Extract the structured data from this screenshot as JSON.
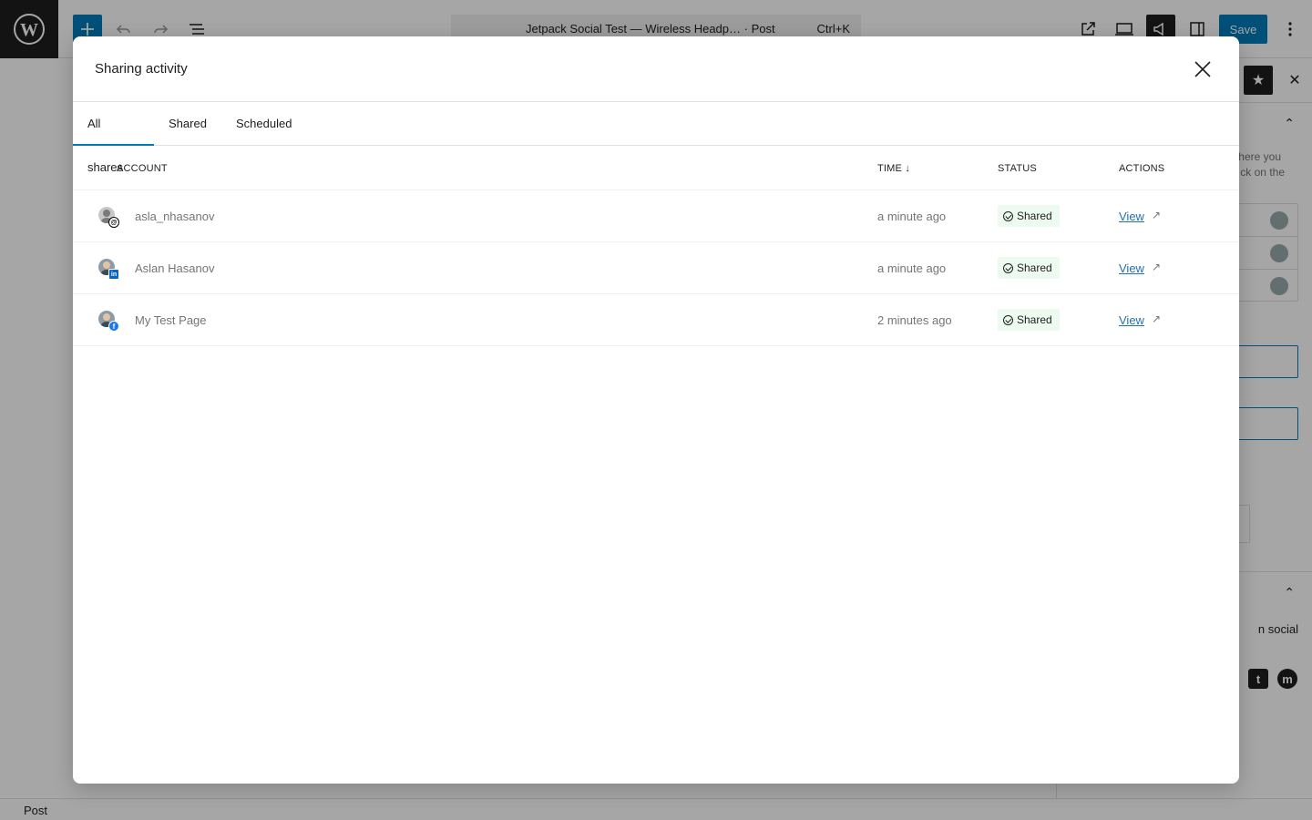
{
  "editor": {
    "doc_title": "Jetpack Social Test — Wireless Headp… · Post",
    "shortcut": "Ctrl+K",
    "save_label": "Save",
    "status_label": "Post",
    "sidebar_text_1": "where you",
    "sidebar_text_2": "ck on the",
    "sidebar_social_text": "n social"
  },
  "modal": {
    "title": "Sharing activity",
    "tabs": [
      {
        "label": "All shares",
        "active": true
      },
      {
        "label": "Shared",
        "active": false
      },
      {
        "label": "Scheduled",
        "active": false
      }
    ],
    "columns": {
      "account": "Account",
      "time": "Time ↓",
      "status": "Status",
      "actions": "Actions"
    },
    "rows": [
      {
        "account": "asla_nhasanov",
        "network": "threads",
        "time": "a minute ago",
        "status": "Shared",
        "action": "View"
      },
      {
        "account": "Aslan Hasanov",
        "network": "linkedin",
        "time": "a minute ago",
        "status": "Shared",
        "action": "View"
      },
      {
        "account": "My Test Page",
        "network": "facebook",
        "time": "2 minutes ago",
        "status": "Shared",
        "action": "View"
      }
    ]
  }
}
